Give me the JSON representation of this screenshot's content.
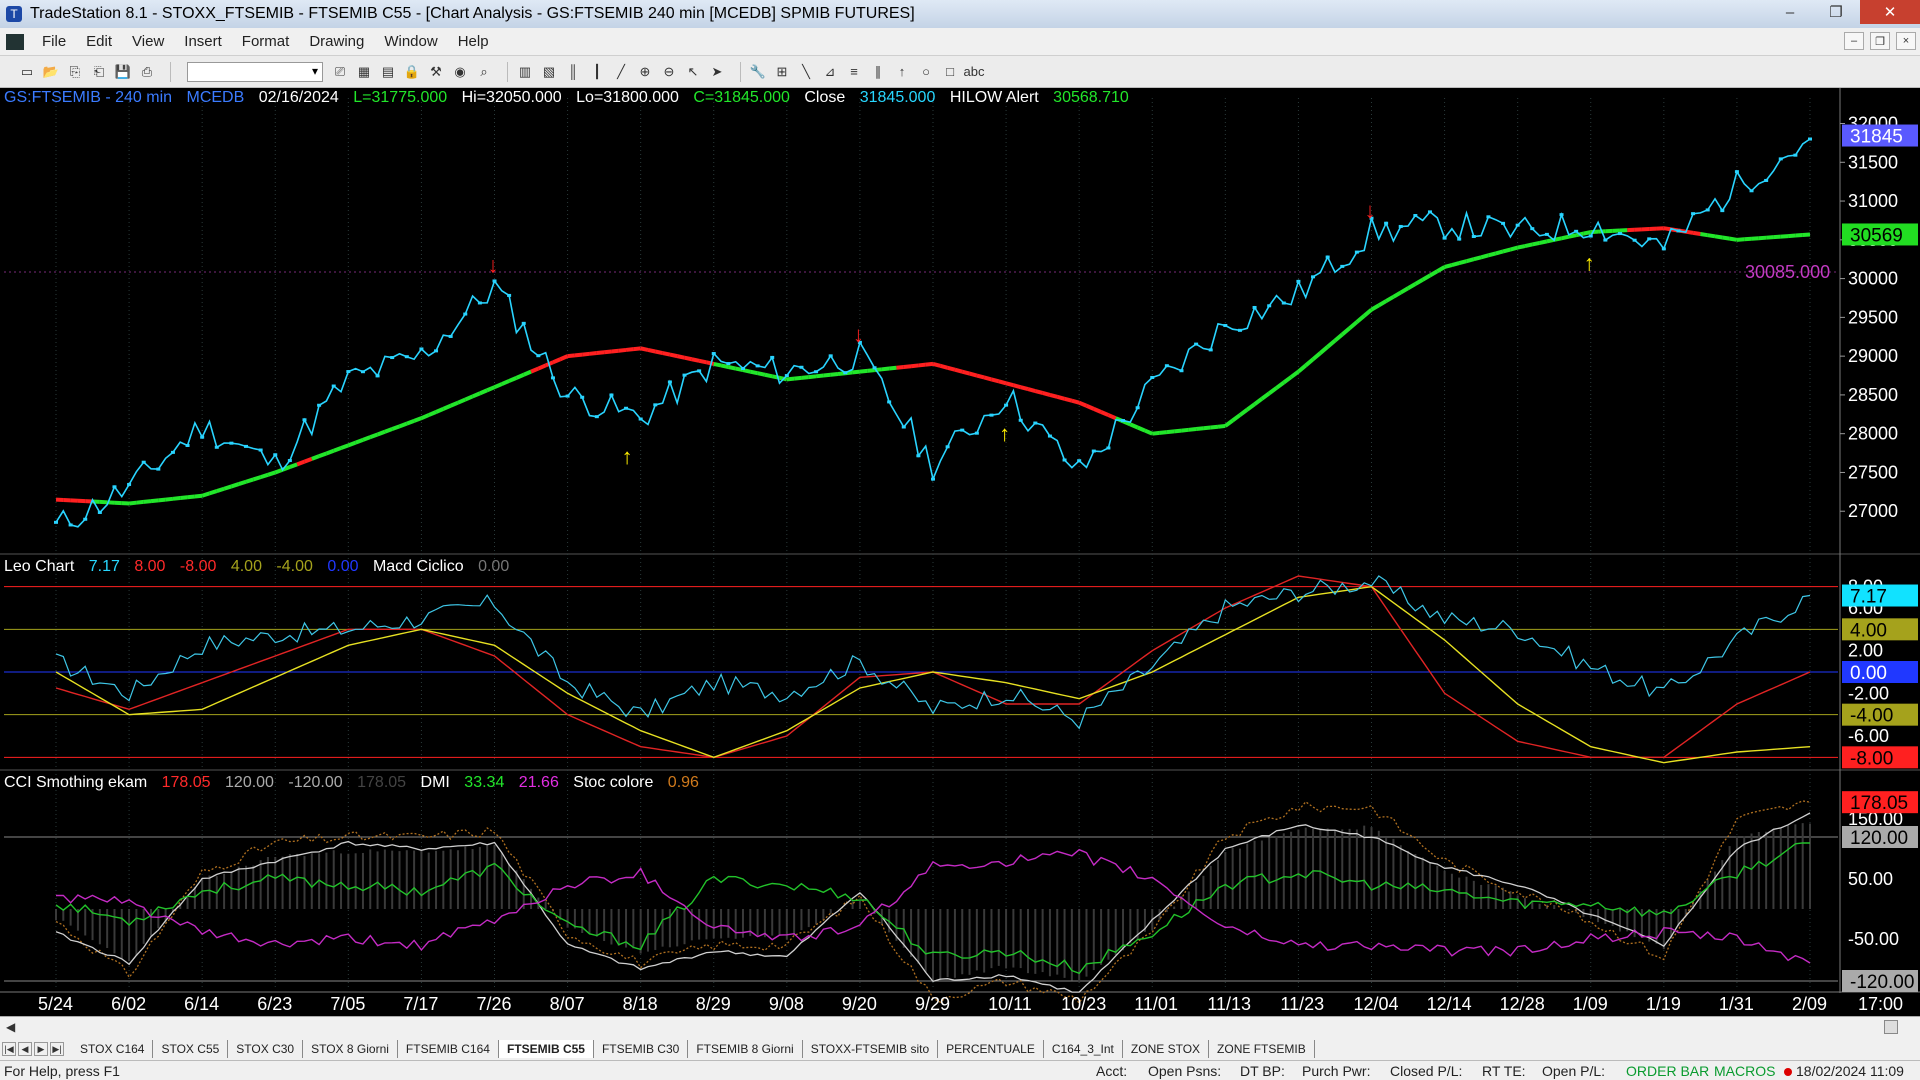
{
  "window": {
    "title": "TradeStation 8.1 - STOXX_FTSEMIB - FTSEMIB C55 - [Chart Analysis - GS:FTSEMIB  240 min  [MCEDB] SPMIB FUTURES]",
    "minimize": "–",
    "maximize": "❐",
    "close": "✕"
  },
  "menu": [
    "File",
    "Edit",
    "View",
    "Insert",
    "Format",
    "Drawing",
    "Window",
    "Help"
  ],
  "mdi_controls": [
    "–",
    "❐",
    "×"
  ],
  "toolbar": {
    "icons": [
      "new-doc-icon",
      "open-folder-icon",
      "copy-icon",
      "paste-icon",
      "save-icon",
      "print-icon",
      "print-preview-icon",
      "workspace-icon",
      "workspace2-icon",
      "lock-icon",
      "tools-icon",
      "globe-icon",
      "find-icon",
      "chart-icon",
      "chart2-icon",
      "bars-icon",
      "candles-icon",
      "line-icon",
      "zoom-in-icon",
      "zoom-out-icon",
      "pointer-icon",
      "cursor-icon",
      "wrench-icon",
      "insert-icon",
      "trendline-icon",
      "gann-icon",
      "fib-icon",
      "channel-icon",
      "arrow-up-icon",
      "circle-icon",
      "rect-icon",
      "text-icon"
    ],
    "combo_value": ""
  },
  "price_panel": {
    "legend": {
      "symbol": "GS:FTSEMIB - 240 min",
      "feed": "MCEDB",
      "date": "02/16/2024",
      "low_first": "L=31775.000",
      "hi": "Hi=32050.000",
      "lo": "Lo=31800.000",
      "close": "C=31845.000",
      "close_label": "Close",
      "close_value": "31845.000",
      "alert_label": "HILOW Alert",
      "alert_value": "30568.710"
    },
    "ref_label": "30085.000",
    "price_badge": "31845",
    "ma_badge": "30569",
    "axis_labels": [
      "32000",
      "31500",
      "31000",
      "30500",
      "30000",
      "29500",
      "29000",
      "28500",
      "28000",
      "27500",
      "27000"
    ]
  },
  "macd_panel": {
    "legend": {
      "name": "Leo Chart",
      "v1": "7.17",
      "v2": "8.00",
      "v3": "-8.00",
      "v4": "4.00",
      "v5": "-4.00",
      "v6": "0.00",
      "name2": "Macd Ciclico",
      "v7": "0.00"
    },
    "axis_labels": [
      "8.00",
      "6.00",
      "4.00",
      "2.00",
      "0.00",
      "-2.00",
      "-4.00",
      "-6.00",
      "-8.00"
    ],
    "badges": {
      "value": "7.17",
      "four": "4.00",
      "zero": "0.00",
      "neg_four": "-4.00",
      "neg_eight": "-8.00"
    }
  },
  "cci_panel": {
    "legend": {
      "name": "CCI Smothing ekam",
      "v1": "178.05",
      "v2": "120.00",
      "v3": "-120.00",
      "v4": "178.05",
      "dmi_label": "DMI",
      "dmi_plus": "33.34",
      "dmi_minus": "21.66",
      "stoc_label": "Stoc colore",
      "stoc_value": "0.96"
    },
    "axis_labels": [
      "150.00",
      "50.00",
      "-50.00"
    ],
    "badges": {
      "value": "178.05",
      "upper": "120.00",
      "lower": "-120.00"
    }
  },
  "time_axis": [
    "5/24",
    "6/02",
    "6/14",
    "6/23",
    "7/05",
    "7/17",
    "7/26",
    "8/07",
    "8/18",
    "8/29",
    "9/08",
    "9/20",
    "9/29",
    "10/11",
    "10/23",
    "11/01",
    "11/13",
    "11/23",
    "12/04",
    "12/14",
    "12/28",
    "1/09",
    "1/19",
    "1/31",
    "2/09",
    "17:00"
  ],
  "chart_data": [
    {
      "type": "line",
      "title": "GS:FTSEMIB - 240 min",
      "x": [
        "5/24",
        "6/02",
        "6/14",
        "6/23",
        "7/05",
        "7/17",
        "7/26",
        "8/07",
        "8/18",
        "8/29",
        "9/08",
        "9/20",
        "9/29",
        "10/11",
        "10/23",
        "11/01",
        "11/13",
        "11/23",
        "12/04",
        "12/14",
        "12/28",
        "1/09",
        "1/19",
        "1/31",
        "2/09"
      ],
      "series": [
        {
          "values": [
            26800,
            27300,
            28100,
            27600,
            28700,
            29000,
            29900,
            28500,
            28200,
            28900,
            28800,
            29000,
            27600,
            28500,
            27500,
            28600,
            29400,
            29800,
            30600,
            30700,
            30600,
            30700,
            30400,
            31200,
            31800
          ]
        },
        {
          "values": [
            27150,
            27100,
            27200,
            27500,
            27850,
            28200,
            28600,
            29000,
            29100,
            28900,
            28700,
            28800,
            28900,
            28650,
            28400,
            28000,
            28100,
            28800,
            29600,
            30150,
            30400,
            30600,
            30650,
            30500,
            30569
          ]
        }
      ],
      "ylim": [
        26500,
        32200
      ],
      "reference_line": 30085
    },
    {
      "type": "line",
      "x": [
        "5/24",
        "6/02",
        "6/14",
        "6/23",
        "7/05",
        "7/17",
        "7/26",
        "8/07",
        "8/18",
        "8/29",
        "9/08",
        "9/20",
        "9/29",
        "10/11",
        "10/23",
        "11/01",
        "11/13",
        "11/23",
        "12/04",
        "12/14",
        "12/28",
        "1/09",
        "1/19",
        "1/31",
        "2/09"
      ],
      "series": [
        {
          "values": [
            1.0,
            -2.0,
            2.5,
            3.5,
            4.0,
            5.0,
            6.5,
            -1.0,
            -4.0,
            -1.0,
            -2.0,
            1.0,
            -3.5,
            -2.0,
            -4.5,
            0.5,
            6.0,
            7.5,
            8.5,
            5.0,
            4.0,
            0.5,
            -2.0,
            3.0,
            7.17
          ]
        },
        {
          "values": [
            -1.5,
            -3.5,
            -1.0,
            1.5,
            4.0,
            4.0,
            1.5,
            -4.0,
            -7.0,
            -8.0,
            -6.0,
            -0.5,
            0.0,
            -3.0,
            -3.0,
            2.0,
            6.0,
            9.0,
            8.0,
            -2.0,
            -6.5,
            -8.0,
            -8.0,
            -3.0,
            0.0
          ]
        },
        {
          "values": [
            0.0,
            -4.0,
            -3.5,
            -0.5,
            2.5,
            4.0,
            2.5,
            -2.0,
            -5.5,
            -8.0,
            -5.5,
            -1.5,
            0.0,
            -1.0,
            -2.5,
            0.0,
            3.5,
            7.0,
            8.0,
            3.0,
            -3.0,
            -7.0,
            -8.5,
            -7.5,
            -7.0
          ]
        }
      ],
      "ylim": [
        -9,
        9
      ],
      "levels": [
        8,
        4,
        0,
        -4,
        -8
      ]
    },
    {
      "type": "line",
      "x": [
        "5/24",
        "6/02",
        "6/14",
        "6/23",
        "7/05",
        "7/17",
        "7/26",
        "8/07",
        "8/18",
        "8/29",
        "9/08",
        "9/20",
        "9/29",
        "10/11",
        "10/23",
        "11/01",
        "11/13",
        "11/23",
        "12/04",
        "12/14",
        "12/28",
        "1/09",
        "1/19",
        "1/31",
        "2/09"
      ],
      "series": [
        {
          "values": [
            -20,
            -110,
            60,
            110,
            120,
            120,
            130,
            -40,
            -90,
            -60,
            -60,
            20,
            -150,
            -120,
            -150,
            -40,
            120,
            170,
            170,
            80,
            30,
            -20,
            -80,
            150,
            178
          ]
        },
        {
          "values": [
            -40,
            -90,
            50,
            80,
            110,
            100,
            110,
            -60,
            -100,
            -70,
            -80,
            30,
            -120,
            -110,
            -140,
            -20,
            100,
            140,
            120,
            70,
            40,
            -10,
            -60,
            100,
            160
          ]
        },
        {
          "values": [
            10,
            -20,
            30,
            50,
            40,
            30,
            70,
            -30,
            -60,
            50,
            40,
            20,
            -80,
            -70,
            -100,
            -40,
            40,
            60,
            40,
            30,
            10,
            10,
            -10,
            60,
            110
          ]
        },
        {
          "values": [
            20,
            10,
            -40,
            -60,
            -50,
            -60,
            -20,
            40,
            60,
            -30,
            -50,
            -30,
            70,
            80,
            90,
            50,
            -30,
            -60,
            -60,
            -70,
            -70,
            -50,
            -40,
            -50,
            -90
          ]
        }
      ],
      "ylim": [
        -135,
        195
      ],
      "levels": [
        120,
        -120
      ]
    }
  ]
}
